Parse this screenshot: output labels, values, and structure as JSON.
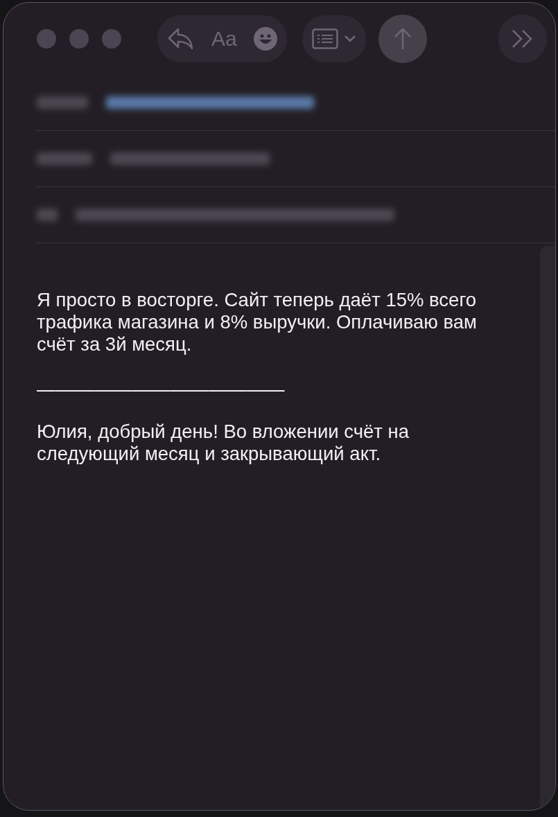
{
  "toolbar": {
    "format_label": "Aa"
  },
  "header_fields": [
    {
      "highlighted": true
    },
    {
      "highlighted": false
    },
    {
      "highlighted": false
    }
  ],
  "body": [
    {
      "kind": "paragraph",
      "text": "Я просто в восторге. Сайт теперь даёт 15% всего трафика магазина и 8% выручки. Оплачиваю вам счёт за 3й месяц."
    },
    {
      "kind": "separator",
      "text": "—————————————"
    },
    {
      "kind": "paragraph",
      "text": "Юлия, добрый день! Во вложении счёт на следующий месяц и закрывающий акт."
    }
  ]
}
